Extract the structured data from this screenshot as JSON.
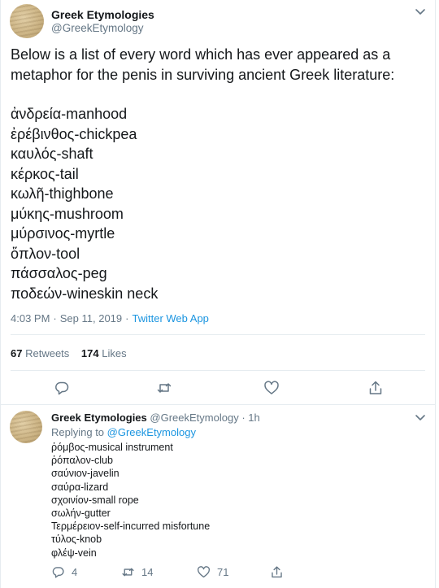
{
  "main_tweet": {
    "author_name": "Greek Etymologies",
    "author_handle": "@GreekEtymology",
    "text_intro": "Below is a list of every word which has ever appeared as a metaphor for the penis in surviving ancient Greek literature:",
    "words": [
      "ἀνδρεία-manhood",
      "ἐρέβινθος-chickpea",
      "καυλός-shaft",
      "κέρκος-tail",
      "κωλῆ-thighbone",
      "μύκης-mushroom",
      "μύρσινος-myrtle",
      "ὅπλον-tool",
      "πάσσαλος-peg",
      "ποδεών-wineskin neck"
    ],
    "time": "4:03 PM",
    "date": "Sep 11, 2019",
    "source": "Twitter Web App",
    "retweets_count": "67",
    "retweets_label": "Retweets",
    "likes_count": "174",
    "likes_label": "Likes"
  },
  "reply_tweet": {
    "author_name": "Greek Etymologies",
    "author_handle": "@GreekEtymology",
    "time_ago": "1h",
    "replying_to_label": "Replying to",
    "replying_to_handle": "@GreekEtymology",
    "lines": [
      "ῥόμβος-musical instrument",
      "ῥόπαλον-club",
      "σαύνιον-javelin",
      "σαύρα-lizard",
      "σχοινίον-small rope",
      "σωλήν-gutter",
      "Τερμέρειον-self-incurred misfortune",
      "τύλος-knob",
      "φλέψ-vein"
    ],
    "reply_count": "4",
    "retweet_count": "14",
    "like_count": "71"
  },
  "colors": {
    "text": "#14171a",
    "secondary": "#657786",
    "link": "#1b95e0",
    "divider": "#e6ecf0"
  },
  "icons": {
    "reply": "reply-icon",
    "retweet": "retweet-icon",
    "like": "heart-icon",
    "share": "share-icon",
    "menu": "chevron-down-icon"
  }
}
